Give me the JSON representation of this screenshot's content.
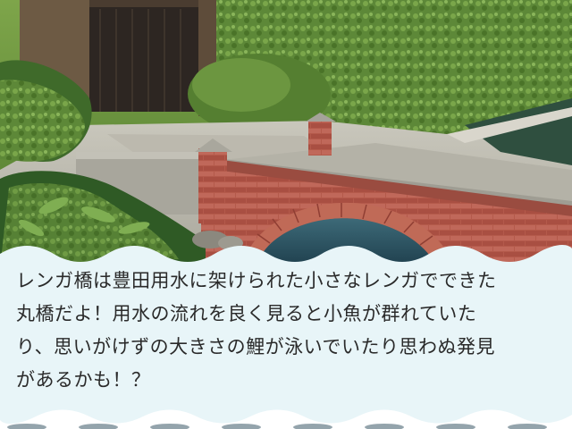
{
  "caption": {
    "lines": [
      "レンガ橋は豊田用水に架けられた小さなレンガでできた",
      "丸橋だよ！用水の流れを良く見ると小魚が群れていた",
      "り、思いがけずの大きさの鯉が泳いでいたり思わぬ発見",
      "があるかも！？"
    ]
  },
  "colors": {
    "caption_bg": "#e8f5f8",
    "brick": "#b5584a",
    "hedge": "#5f8a3a",
    "water": "#2f5a6e"
  }
}
